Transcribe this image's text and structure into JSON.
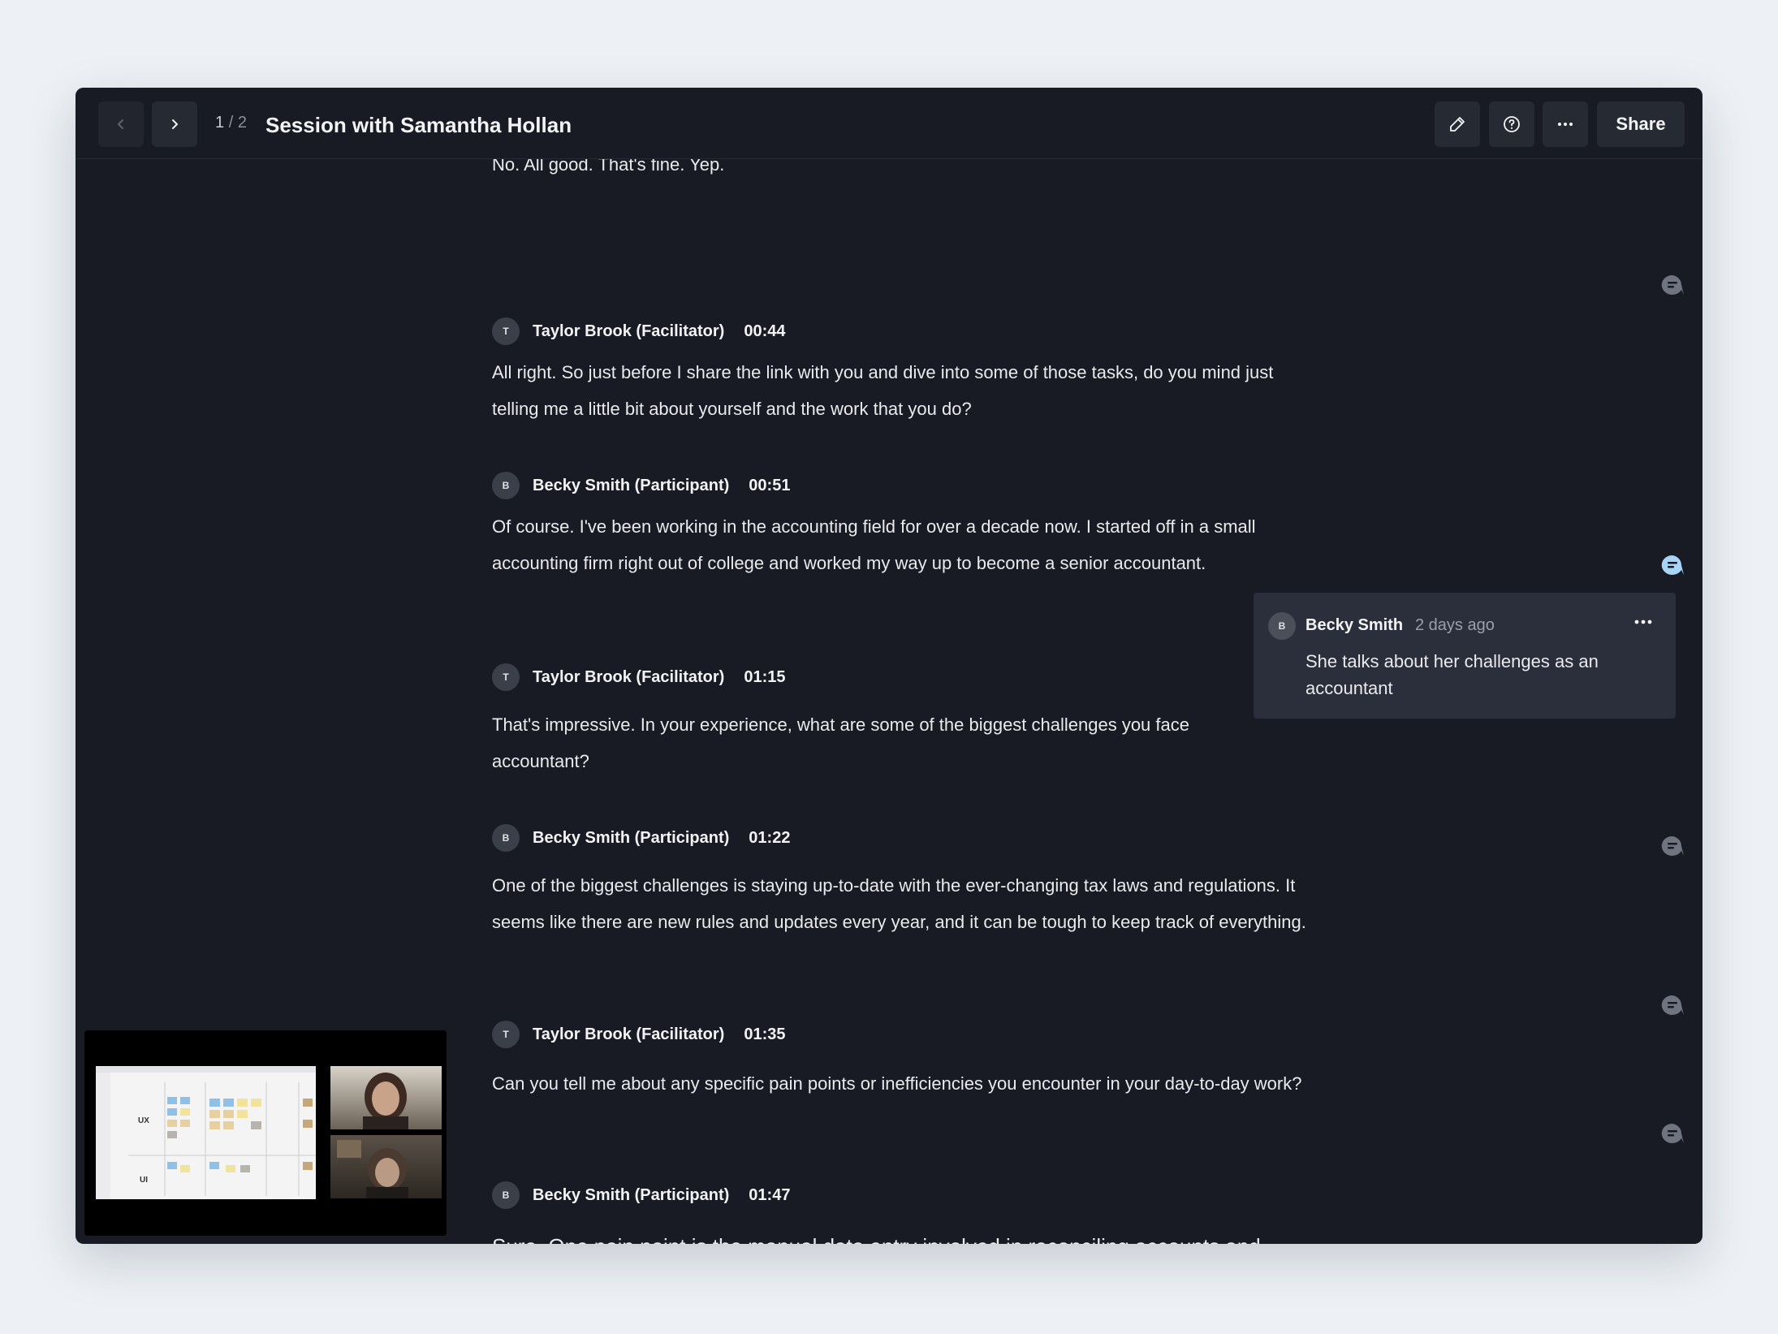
{
  "header": {
    "counter_current": "1",
    "counter_sep": "/",
    "counter_total": "2",
    "title": "Session with Samantha Hollan",
    "share_label": "Share",
    "icons": [
      "chevron-left-icon",
      "chevron-right-icon",
      "pencil-icon",
      "help-icon",
      "more-icon"
    ]
  },
  "transcript": {
    "intro_text": "No. All good. That's fine. Yep.",
    "entries": [
      {
        "initial": "T",
        "speaker": "Taylor Brook (Facilitator)",
        "time": "00:44",
        "text": "All right. So just before I share the link with you and dive into some of those tasks, do you mind just telling me a little bit about yourself and the work that you do?"
      },
      {
        "initial": "B",
        "speaker": "Becky Smith (Participant)",
        "time": "00:51",
        "text": "Of course. I've been working in the accounting field for over a decade now. I started off in a small accounting firm right out of college and worked my way up to become a senior accountant."
      },
      {
        "initial": "T",
        "speaker": "Taylor Brook (Facilitator)",
        "time": "01:15",
        "text": "That's impressive. In your experience, what are some of the biggest challenges you face accountant?"
      },
      {
        "initial": "B",
        "speaker": "Becky Smith (Participant)",
        "time": "01:22",
        "text": "One of the biggest challenges is staying up-to-date with the ever-changing tax laws and regulations. It seems like there are new rules and updates every year, and it can be tough to keep track of everything."
      },
      {
        "initial": "T",
        "speaker": "Taylor Brook (Facilitator)",
        "time": "01:35",
        "text": "Can you tell me about any specific pain points or inefficiencies you encounter in your day-to-day work?"
      },
      {
        "initial": "B",
        "speaker": "Becky Smith (Participant)",
        "time": "01:47",
        "text": "Sure. One pain point is the manual data entry involved in reconciling accounts and preparing financial statements."
      }
    ]
  },
  "comment": {
    "initial": "B",
    "author": "Becky Smith",
    "time": "2 days ago",
    "text": "She talks about her challenges as an accountant"
  },
  "video": {
    "board_labels": [
      "UX",
      "UI"
    ]
  },
  "colors": {
    "background": "#edf1f5",
    "panel": "#181b23",
    "comment_active": "#a8d4f5",
    "comment_inactive": "#707480"
  }
}
